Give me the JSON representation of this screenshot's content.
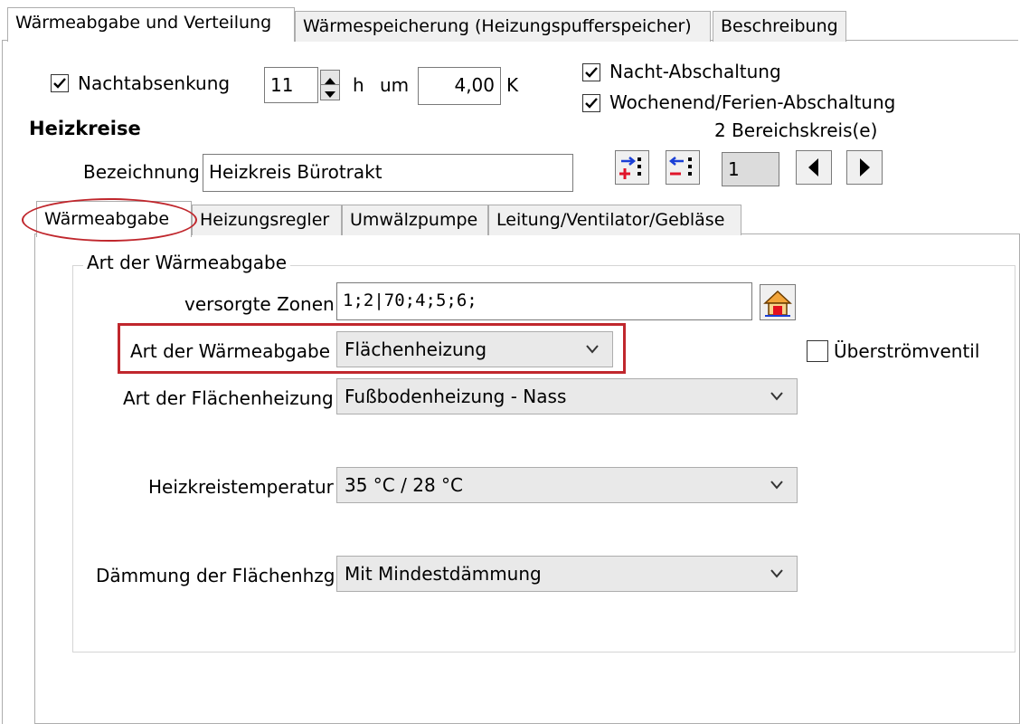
{
  "outer_tabs": [
    {
      "label": "Wärmeabgabe und Verteilung"
    },
    {
      "label": "Wärmespeicherung (Heizungspufferspeicher)"
    },
    {
      "label": "Beschreibung"
    }
  ],
  "night": {
    "checkbox_label": "Nachtabsenkung",
    "checked": true,
    "hours_value": "11",
    "hours_unit": "h",
    "um_label": "um",
    "kelvin_value": "4,00",
    "kelvin_unit": "K"
  },
  "switches": {
    "night_off": "Nacht-Abschaltung",
    "weekend_off": "Wochenend/Ferien-Abschaltung"
  },
  "heizkreise": {
    "heading": "Heizkreise",
    "bezeichnung_label": "Bezeichnung",
    "bezeichnung_value": "Heizkreis Bürotrakt",
    "count_text": "2 Bereichskreis(e)",
    "index_value": "1"
  },
  "inner_tabs": [
    {
      "label": "Wärmeabgabe"
    },
    {
      "label": "Heizungsregler"
    },
    {
      "label": "Umwälzpumpe"
    },
    {
      "label": "Leitung/Ventilator/Gebläse"
    }
  ],
  "group": {
    "legend": "Art der Wärmeabgabe",
    "zonen_label": "versorgte Zonen",
    "zonen_value": "1;2|70;4;5;6;",
    "art_label": "Art der Wärmeabgabe",
    "art_value": "Flächenheizung",
    "overflow_label": "Überströmventil",
    "flaeche_label": "Art der Flächenheizung",
    "flaeche_value": "Fußbodenheizung - Nass",
    "temp_label": "Heizkreistemperatur",
    "temp_value": "35 °C / 28 °C",
    "daemmung_label": "Dämmung der Flächenhzg.",
    "daemmung_value": "Mit Mindestdämmung"
  },
  "colors": {
    "annotation_red": "#c0272d",
    "tab_bg": "#f0f0f0"
  }
}
